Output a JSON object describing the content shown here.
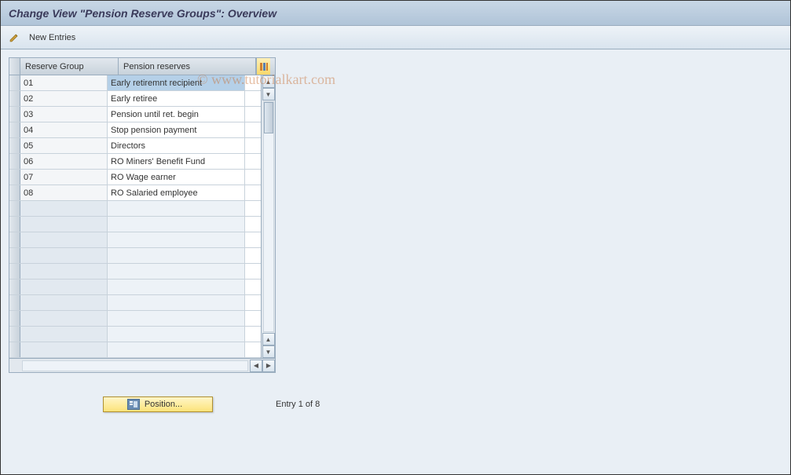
{
  "titlebar": {
    "title": "Change View \"Pension Reserve Groups\": Overview"
  },
  "toolbar": {
    "new_entries_label": "New Entries"
  },
  "watermark": "© www.tutorialkart.com",
  "table": {
    "columns": {
      "group": "Reserve Group",
      "reserves": "Pension reserves"
    },
    "rows": [
      {
        "group": "01",
        "reserves": "Early retiremnt recipient",
        "selected": true
      },
      {
        "group": "02",
        "reserves": "Early retiree"
      },
      {
        "group": "03",
        "reserves": "Pension until ret. begin"
      },
      {
        "group": "04",
        "reserves": "Stop pension payment"
      },
      {
        "group": "05",
        "reserves": "Directors"
      },
      {
        "group": "06",
        "reserves": "RO Miners' Benefit Fund"
      },
      {
        "group": "07",
        "reserves": "RO Wage earner"
      },
      {
        "group": "08",
        "reserves": "RO Salaried employee"
      }
    ],
    "empty_rows": 10
  },
  "footer": {
    "position_label": "Position...",
    "entry_text": "Entry 1 of 8"
  }
}
